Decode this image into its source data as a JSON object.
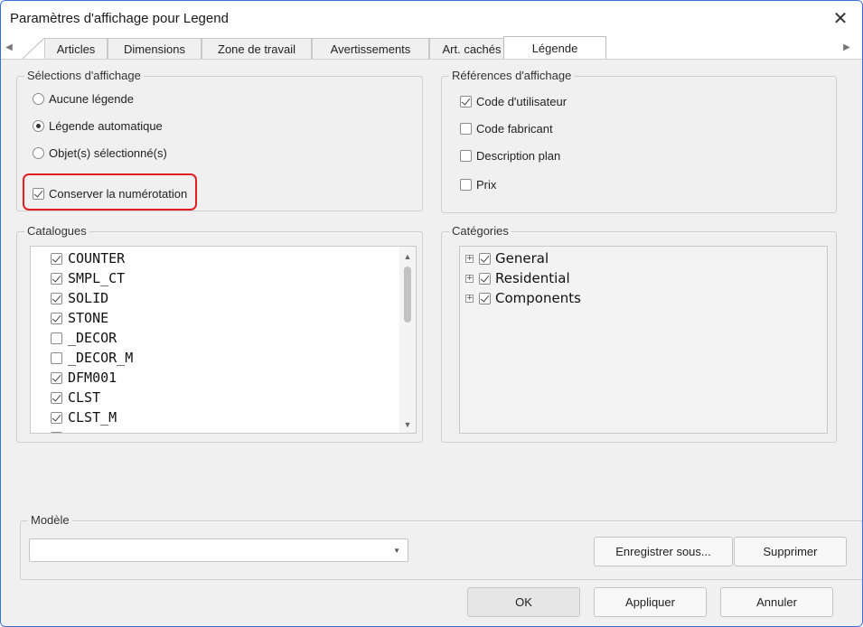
{
  "window": {
    "title": "Paramètres d'affichage pour Legend",
    "close_glyph": "✕"
  },
  "tabs": {
    "scroll_left": "◀",
    "scroll_right": "▶",
    "items": [
      {
        "label": "Articles",
        "active": false
      },
      {
        "label": "Dimensions",
        "active": false
      },
      {
        "label": "Zone de travail",
        "active": false
      },
      {
        "label": "Avertissements",
        "active": false
      },
      {
        "label": "Art. cachés",
        "active": false
      },
      {
        "label": "Légende",
        "active": true
      }
    ]
  },
  "display_selections": {
    "title": "Sélections d'affichage",
    "options": [
      {
        "label": "Aucune légende",
        "selected": false
      },
      {
        "label": "Légende automatique",
        "selected": true
      },
      {
        "label": "Objet(s) sélectionné(s)",
        "selected": false
      }
    ],
    "keep_numbering": {
      "label": "Conserver la numérotation",
      "checked": true
    }
  },
  "display_references": {
    "title": "Références d'affichage",
    "items": [
      {
        "label": "Code d'utilisateur",
        "checked": true
      },
      {
        "label": "Code fabricant",
        "checked": false
      },
      {
        "label": "Description plan",
        "checked": false
      },
      {
        "label": "Prix",
        "checked": false
      }
    ]
  },
  "catalogues": {
    "title": "Catalogues",
    "items": [
      {
        "label": "COUNTER",
        "checked": true
      },
      {
        "label": "SMPL_CT",
        "checked": true
      },
      {
        "label": "SOLID",
        "checked": true
      },
      {
        "label": "STONE",
        "checked": true
      },
      {
        "label": "_DECOR",
        "checked": false
      },
      {
        "label": "_DECOR_M",
        "checked": false
      },
      {
        "label": "DFM001",
        "checked": true
      },
      {
        "label": "CLST",
        "checked": true
      },
      {
        "label": "CLST_M",
        "checked": true
      }
    ],
    "scroll_up": "▲",
    "scroll_down": "▼"
  },
  "categories": {
    "title": "Catégories",
    "items": [
      {
        "label": "General",
        "checked": true,
        "expander": "+"
      },
      {
        "label": "Residential",
        "checked": true,
        "expander": "+"
      },
      {
        "label": "Components",
        "checked": true,
        "expander": "+"
      }
    ]
  },
  "model": {
    "title": "Modèle",
    "value": "",
    "dropdown_glyph": "▼",
    "save_as_label": "Enregistrer sous...",
    "delete_label": "Supprimer"
  },
  "footer": {
    "ok_label": "OK",
    "apply_label": "Appliquer",
    "cancel_label": "Annuler"
  },
  "colors": {
    "window_border": "#3a6fd8",
    "highlight": "#e02020",
    "background": "#f0f0f0"
  }
}
